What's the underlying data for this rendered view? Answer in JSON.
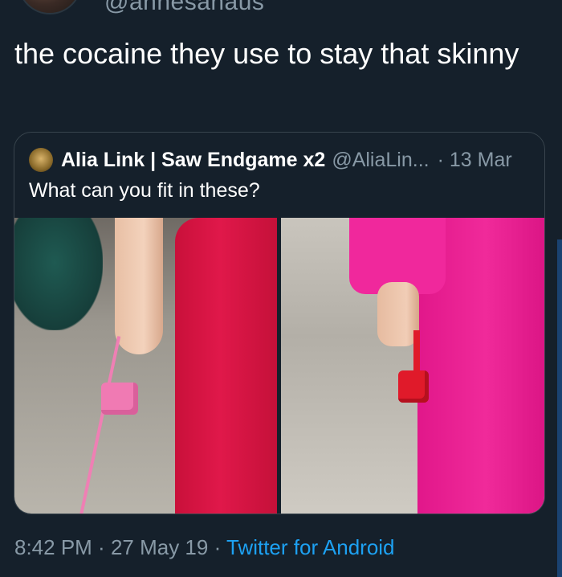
{
  "tweet": {
    "handle": "@annesanaus",
    "text": "the cocaine they use to stay that skinny"
  },
  "quoted_tweet": {
    "name": "Alia Link | Saw Endgame x2",
    "handle": "@AliaLin...",
    "time": "· 13 Mar",
    "text": "What can you fit in these?"
  },
  "meta": {
    "time": "8:42 PM",
    "separator": " · ",
    "date": "27 May 19",
    "separator2": " · ",
    "source": "Twitter for Android"
  },
  "colors": {
    "background": "#15202b",
    "link": "#1da1f2",
    "secondary_text": "#8899a6"
  }
}
